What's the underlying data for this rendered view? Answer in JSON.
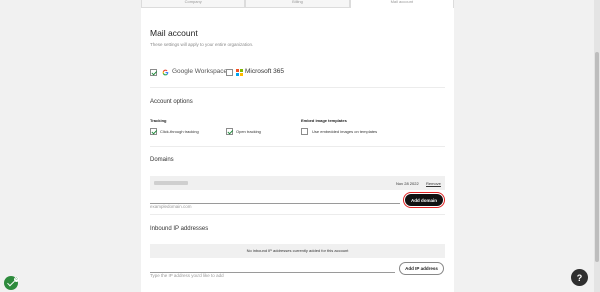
{
  "tabs": [
    {
      "label": "Company",
      "active": false
    },
    {
      "label": "Billing",
      "active": false
    },
    {
      "label": "Mail account",
      "active": true
    }
  ],
  "page": {
    "title": "Mail account",
    "subtitle": "These settings will apply to your entire organization."
  },
  "providers": [
    {
      "label": "Google Workspace",
      "checked": true,
      "icon": "google-logo-icon"
    },
    {
      "label": "Microsoft 365",
      "checked": false,
      "icon": "microsoft-logo-icon"
    }
  ],
  "account_options": {
    "heading": "Account options",
    "tracking": {
      "label": "Tracking",
      "click_through": {
        "label": "Click-through tracking",
        "checked": true
      },
      "open": {
        "label": "Open tracking",
        "checked": true
      }
    },
    "embed": {
      "label": "Embed image templates",
      "embedded_images": {
        "label": "Use embedded images on templates",
        "checked": false
      }
    }
  },
  "domains": {
    "heading": "Domains",
    "items": [
      {
        "date": "Nov 28 2022",
        "remove_label": "Remove"
      }
    ],
    "input_placeholder": "exampledomain.com",
    "add_label": "Add domain"
  },
  "inbound_ip": {
    "heading": "Inbound IP addresses",
    "empty_message": "No inbound IP addresses currently added for this account",
    "input_placeholder": "Type the IP address you'd like to add",
    "add_label": "Add IP address"
  },
  "help": {
    "label": "?"
  },
  "status_badge": {
    "count": "0"
  },
  "colors": {
    "accent_green": "#2e8b3d",
    "primary_button": "#111111",
    "focus_ring": "#e02424"
  }
}
